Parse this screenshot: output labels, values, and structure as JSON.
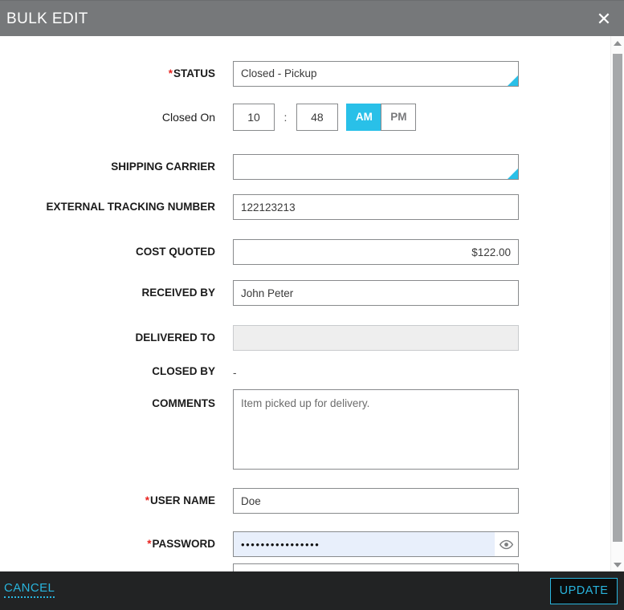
{
  "dialog": {
    "title": "BULK EDIT",
    "close_icon": "close-icon"
  },
  "fields": {
    "status": {
      "label": "STATUS",
      "required": true,
      "value": "Closed - Pickup"
    },
    "closed_on": {
      "label": "Closed On",
      "hour": "10",
      "separator": ":",
      "minute": "48",
      "am_label": "AM",
      "pm_label": "PM",
      "selected_meridiem": "AM"
    },
    "shipping_carrier": {
      "label": "SHIPPING CARRIER",
      "value": ""
    },
    "external_tracking_number": {
      "label": "EXTERNAL TRACKING NUMBER",
      "value": "122123213"
    },
    "cost_quoted": {
      "label": "COST QUOTED",
      "value": "$122.00"
    },
    "received_by": {
      "label": "RECEIVED BY",
      "value": "John Peter"
    },
    "delivered_to": {
      "label": "DELIVERED TO",
      "value": "",
      "disabled": true
    },
    "closed_by": {
      "label": "CLOSED BY",
      "value": "-"
    },
    "comments": {
      "label": "COMMENTS",
      "value": "Item picked up for delivery."
    },
    "user_name": {
      "label": "USER NAME",
      "required": true,
      "value": "Doe"
    },
    "password": {
      "label": "PASSWORD",
      "required": true,
      "value": "••••••••••••••••",
      "toggle_icon": "eye-icon"
    },
    "next_field": {
      "value": ""
    }
  },
  "footer": {
    "cancel_label": "CANCEL",
    "update_label": "UPDATE"
  },
  "colors": {
    "accent": "#29c0e8",
    "footer_accent": "#29b5de",
    "titlebar": "#76787a",
    "footer_bg": "#222324",
    "required": "#e8231f",
    "autofill": "#e8effb"
  }
}
